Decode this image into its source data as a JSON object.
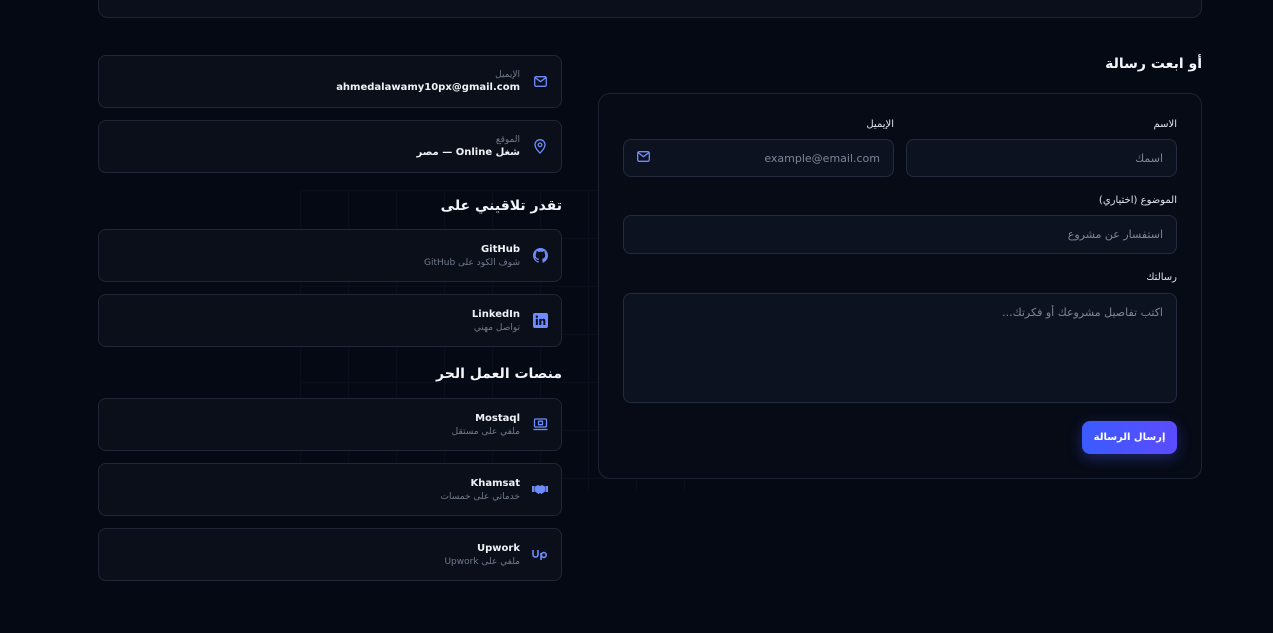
{
  "contact": {
    "email_label": "الإيميل",
    "email_value": "ahmedalawamy10px@gmail.com",
    "location_label": "الموقع",
    "location_value": "شغل Online — مصر"
  },
  "meet_section": {
    "title": "تقدر تلاقيني على",
    "items": [
      {
        "name": "GitHub",
        "sub": "شوف الكود على GitHub",
        "icon": "github-icon"
      },
      {
        "name": "LinkedIn",
        "sub": "تواصل مهني",
        "icon": "linkedin-icon"
      }
    ]
  },
  "freelance_section": {
    "title": "منصات العمل الحر",
    "items": [
      {
        "name": "Mostaql",
        "sub": "ملفي على مستقل",
        "icon": "mostaql-icon"
      },
      {
        "name": "Khamsat",
        "sub": "خدماتي على خمسات",
        "icon": "handshake-icon"
      },
      {
        "name": "Upwork",
        "sub": "ملفي على Upwork",
        "icon": "upwork-icon"
      }
    ]
  },
  "form": {
    "title": "أو ابعت رسالة",
    "name_label": "الاسم",
    "name_placeholder": "اسمك",
    "email_label": "الإيميل",
    "email_placeholder": "example@email.com",
    "subject_label": "الموضوع (اختياري)",
    "subject_placeholder": "استفسار عن مشروع",
    "message_label": "رسالتك",
    "message_placeholder": "اكتب تفاصيل مشروعك أو فكرتك...",
    "submit_label": "إرسال الرسالة"
  },
  "colors": {
    "accent": "#5b6dff",
    "background": "#050913"
  }
}
